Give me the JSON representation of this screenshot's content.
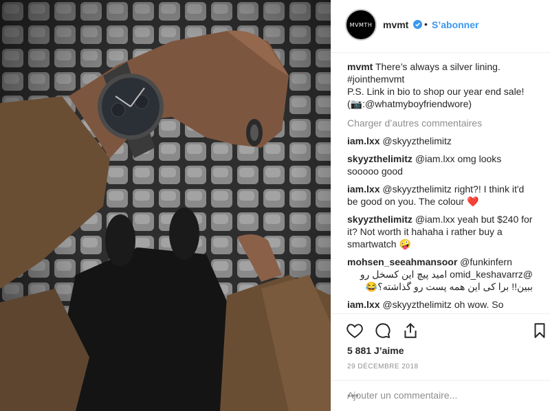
{
  "header": {
    "avatar_text": "MVMTH",
    "username": "mvmt",
    "dot": "•",
    "follow_label": "S’abonner"
  },
  "caption": {
    "user": "mvmt",
    "line1": " There’s always a silver lining.",
    "line2": "#jointhemvmt",
    "line3": "P.S. Link in bio to shop our year end sale!",
    "line4": "(📷:@whatmyboyfriendwore)"
  },
  "load_more": "Charger d’autres commentaires",
  "comments": [
    {
      "user": "iam.lxx",
      "text": " @skyyzthelimitz"
    },
    {
      "user": "skyyzthelimitz",
      "text": " @iam.lxx omg looks sooooo good"
    },
    {
      "user": "iam.lxx",
      "text": " @skyyzthelimitz right?! I think it'd be good on you. The colour ❤️"
    },
    {
      "user": "skyyzthelimitz",
      "text": " @iam.lxx yeah but $240 for it? Not worth it hahaha i rather buy a smartwatch 🤪"
    },
    {
      "user": "mohsen_seeahmansoor",
      "text": " @funkinfern",
      "rtl": "@omid_keshavarrz امید پیچ این کسخل رو ببین!! برا کی این همه پست رو گذاشته؟😂"
    },
    {
      "user": "iam.lxx",
      "text": " @skyyzthelimitz oh wow. So"
    }
  ],
  "likes": "5 881 J’aime",
  "date": "29 DÉCEMBRE 2018",
  "add_comment_placeholder": "Ajouter un commentaire...",
  "more_label": "•••",
  "colors": {
    "accent": "#3897f0",
    "muted": "#8e8e8e",
    "text": "#262626"
  }
}
